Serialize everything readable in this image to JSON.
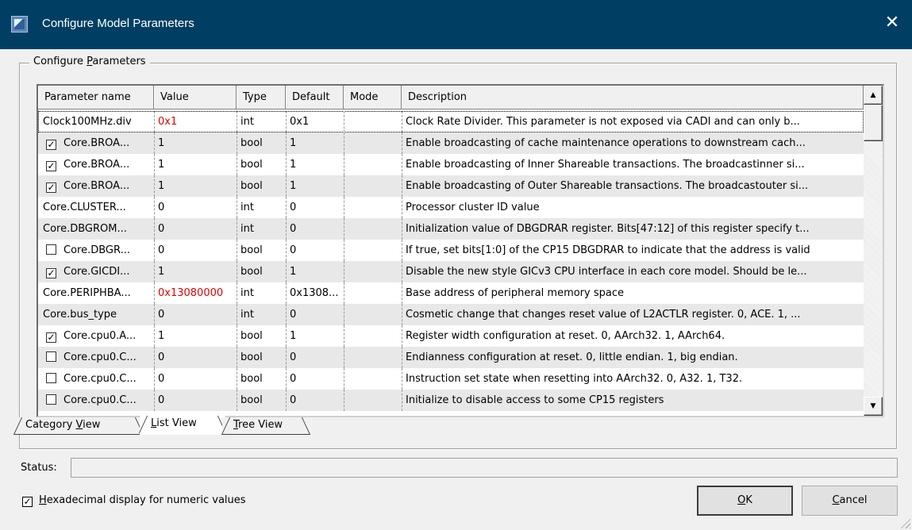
{
  "window": {
    "title": "Configure Model Parameters",
    "close_glyph": "✕"
  },
  "group": {
    "label_prefix": "Configure ",
    "label_accel": "P",
    "label_suffix": "arameters"
  },
  "table": {
    "columns": [
      "Parameter name",
      "Value",
      "Type",
      "Default",
      "Mode",
      "Description"
    ],
    "rows": [
      {
        "checkbox": null,
        "name": "Clock100MHz.div",
        "value": "0x1",
        "value_red": true,
        "type": "int",
        "default": "0x1",
        "mode": "",
        "description": "Clock Rate Divider. This parameter is not exposed via CADI and can only b..."
      },
      {
        "checkbox": true,
        "name": "Core.BROA...",
        "value": "1",
        "value_red": false,
        "type": "bool",
        "default": "1",
        "mode": "",
        "description": "Enable broadcasting of cache maintenance operations to downstream cach..."
      },
      {
        "checkbox": true,
        "name": "Core.BROA...",
        "value": "1",
        "value_red": false,
        "type": "bool",
        "default": "1",
        "mode": "",
        "description": "Enable broadcasting of Inner Shareable transactions. The broadcastinner si..."
      },
      {
        "checkbox": true,
        "name": "Core.BROA...",
        "value": "1",
        "value_red": false,
        "type": "bool",
        "default": "1",
        "mode": "",
        "description": "Enable broadcasting of Outer Shareable transactions. The broadcastouter si..."
      },
      {
        "checkbox": null,
        "name": "Core.CLUSTER...",
        "value": "0",
        "value_red": false,
        "type": "int",
        "default": "0",
        "mode": "",
        "description": "Processor cluster ID value"
      },
      {
        "checkbox": null,
        "name": "Core.DBGROM...",
        "value": "0",
        "value_red": false,
        "type": "int",
        "default": "0",
        "mode": "",
        "description": "Initialization value of DBGDRAR register. Bits[47:12] of this register specify t..."
      },
      {
        "checkbox": false,
        "name": "Core.DBGR...",
        "value": "0",
        "value_red": false,
        "type": "bool",
        "default": "0",
        "mode": "",
        "description": "If true, set bits[1:0] of the CP15 DBGDRAR to indicate that the address is valid"
      },
      {
        "checkbox": true,
        "name": "Core.GICDI...",
        "value": "1",
        "value_red": false,
        "type": "bool",
        "default": "1",
        "mode": "",
        "description": "Disable the new style GICv3 CPU interface in each core model. Should be le..."
      },
      {
        "checkbox": null,
        "name": "Core.PERIPHBA...",
        "value": "0x13080000",
        "value_red": true,
        "type": "int",
        "default": "0x1308...",
        "mode": "",
        "description": "Base address of peripheral memory space"
      },
      {
        "checkbox": null,
        "name": "Core.bus_type",
        "value": "0",
        "value_red": false,
        "type": "int",
        "default": "0",
        "mode": "",
        "description": "Cosmetic change that changes reset value of L2ACTLR register. 0, ACE. 1, ..."
      },
      {
        "checkbox": true,
        "name": "Core.cpu0.A...",
        "value": "1",
        "value_red": false,
        "type": "bool",
        "default": "1",
        "mode": "",
        "description": "Register width configuration at reset. 0, AArch32. 1, AArch64."
      },
      {
        "checkbox": false,
        "name": "Core.cpu0.C...",
        "value": "0",
        "value_red": false,
        "type": "bool",
        "default": "0",
        "mode": "",
        "description": "Endianness configuration at reset.  0, little endian. 1, big endian."
      },
      {
        "checkbox": false,
        "name": "Core.cpu0.C...",
        "value": "0",
        "value_red": false,
        "type": "bool",
        "default": "0",
        "mode": "",
        "description": "Instruction set state when resetting into AArch32.  0, A32. 1, T32."
      },
      {
        "checkbox": false,
        "name": "Core.cpu0.C...",
        "value": "0",
        "value_red": false,
        "type": "bool",
        "default": "0",
        "mode": "",
        "description": "Initialize to disable access to some CP15 registers"
      }
    ]
  },
  "tabs": [
    {
      "pre": "Category ",
      "accel": "V",
      "post": "iew",
      "active": false
    },
    {
      "pre": "",
      "accel": "L",
      "post": "ist View",
      "active": true
    },
    {
      "pre": "",
      "accel": "T",
      "post": "ree View",
      "active": false
    }
  ],
  "status": {
    "label": "Status:",
    "value": ""
  },
  "hex_option": {
    "checked": true,
    "accel": "H",
    "label_rest": "exadecimal display for numeric values"
  },
  "buttons": {
    "ok_accel": "O",
    "ok_rest": "K",
    "cancel_accel": "C",
    "cancel_rest": "ancel"
  },
  "colors": {
    "title_bar": "#003f63",
    "modified_value": "#e00000",
    "alt_row": "#e8e8e8"
  },
  "icons": {
    "check_glyph": "✓",
    "scroll_up": "▲",
    "scroll_down": "▼"
  }
}
